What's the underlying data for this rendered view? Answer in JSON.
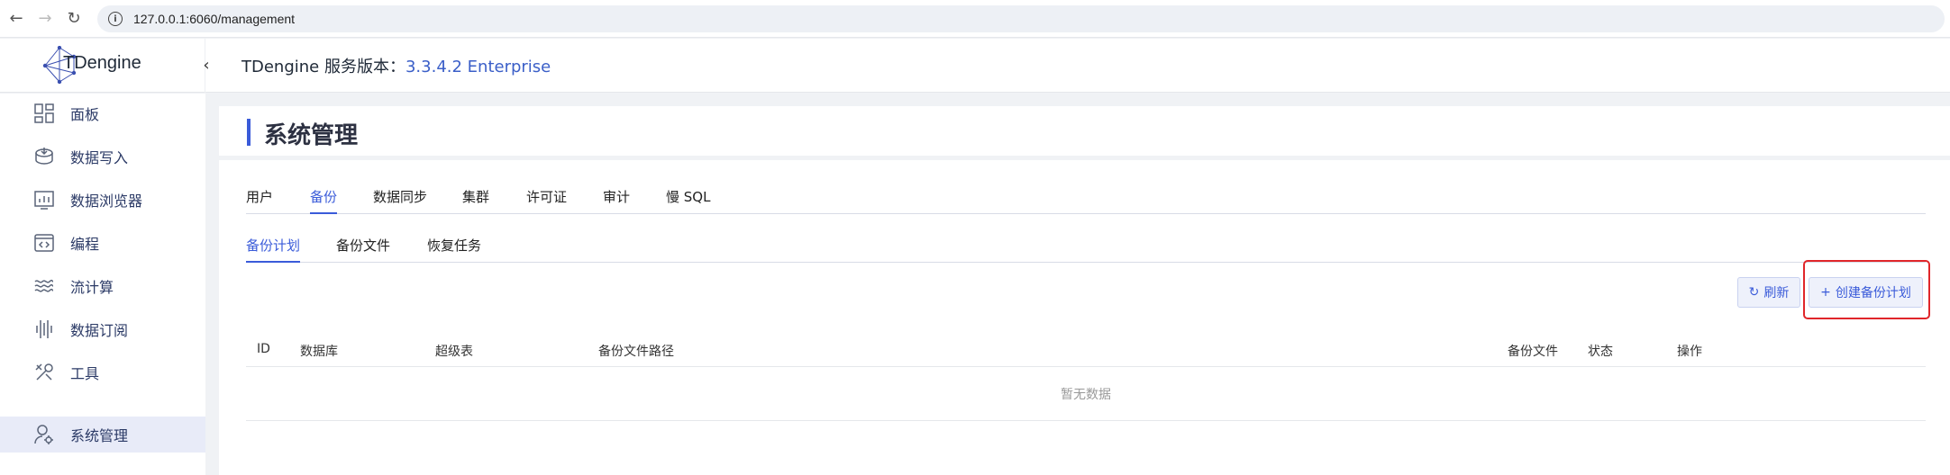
{
  "browser": {
    "url": "127.0.0.1:6060/management"
  },
  "app": {
    "logo_text": "TDengine",
    "header_prefix": "TDengine 服务版本：",
    "header_version": "3.3.4.2 Enterprise"
  },
  "sidebar": {
    "items": [
      {
        "label": "面板",
        "icon": "dashboard-icon"
      },
      {
        "label": "数据写入",
        "icon": "database-in-icon"
      },
      {
        "label": "数据浏览器",
        "icon": "chart-icon"
      },
      {
        "label": "编程",
        "icon": "code-icon"
      },
      {
        "label": "流计算",
        "icon": "waves-icon"
      },
      {
        "label": "数据订阅",
        "icon": "subscribe-icon"
      },
      {
        "label": "工具",
        "icon": "tools-icon"
      },
      {
        "label": "系统管理",
        "icon": "user-settings-icon"
      }
    ]
  },
  "page": {
    "title": "系统管理"
  },
  "tabs": [
    "用户",
    "备份",
    "数据同步",
    "集群",
    "许可证",
    "审计",
    "慢 SQL"
  ],
  "subtabs": [
    "备份计划",
    "备份文件",
    "恢复任务"
  ],
  "toolbar": {
    "refresh_label": "刷新",
    "create_label": "创建备份计划"
  },
  "table": {
    "columns": [
      "ID",
      "数据库",
      "超级表",
      "备份文件路径",
      "备份文件",
      "状态",
      "操作"
    ],
    "empty_text": "暂无数据"
  },
  "colors": {
    "accent": "#3a5bd9",
    "highlight": "#e0262a"
  }
}
